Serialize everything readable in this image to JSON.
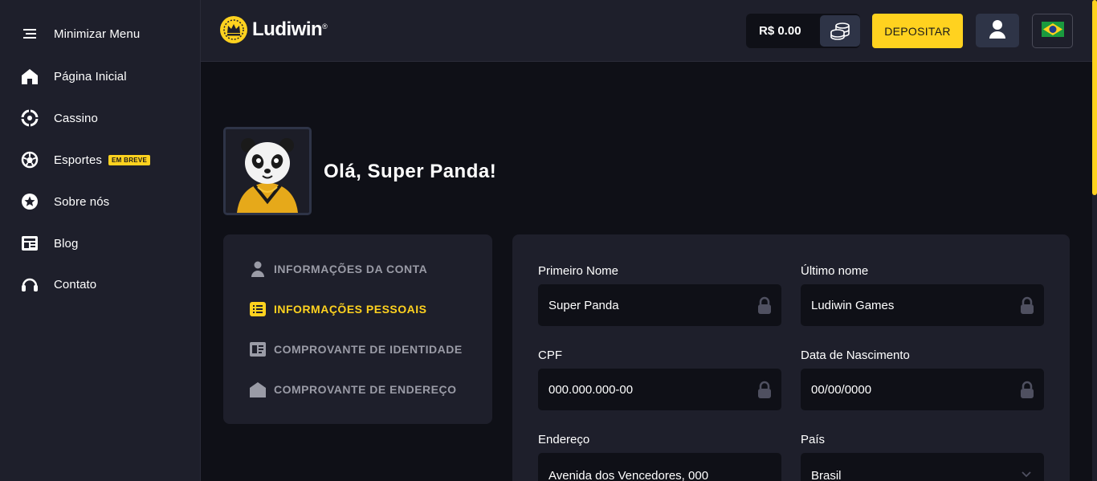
{
  "sidebar": {
    "items": [
      {
        "label": "Minimizar Menu",
        "icon": "menu-icon"
      },
      {
        "label": "Página Inicial",
        "icon": "home-icon"
      },
      {
        "label": "Cassino",
        "icon": "casino-chip-icon"
      },
      {
        "label": "Esportes",
        "icon": "soccer-ball-icon",
        "badge": "EM BREVE"
      },
      {
        "label": "Sobre nós",
        "icon": "star-icon"
      },
      {
        "label": "Blog",
        "icon": "newspaper-icon"
      },
      {
        "label": "Contato",
        "icon": "headset-icon"
      }
    ]
  },
  "header": {
    "logo_text": "Ludiwin",
    "logo_mark": "®",
    "balance": "R$ 0.00",
    "deposit_label": "DEPOSITAR"
  },
  "profile": {
    "greeting": "Olá, Super Panda!"
  },
  "account_menu": {
    "items": [
      {
        "label": "INFORMAÇÕES DA CONTA",
        "icon": "user-icon",
        "active": false
      },
      {
        "label": "INFORMAÇÕES PESSOAIS",
        "icon": "list-icon",
        "active": true
      },
      {
        "label": "COMPROVANTE DE IDENTIDADE",
        "icon": "id-card-icon",
        "active": false
      },
      {
        "label": "COMPROVANTE DE ENDEREÇO",
        "icon": "house-icon",
        "active": false
      }
    ]
  },
  "form": {
    "first_name": {
      "label": "Primeiro Nome",
      "value": "Super Panda"
    },
    "last_name": {
      "label": "Último nome",
      "value": "Ludiwin Games"
    },
    "cpf": {
      "label": "CPF",
      "value": "000.000.000-00"
    },
    "birth_date": {
      "label": "Data de Nascimento",
      "value": "00/00/0000"
    },
    "address": {
      "label": "Endereço",
      "value": "Avenida dos Vencedores, 000"
    },
    "country": {
      "label": "País",
      "value": "Brasil"
    }
  },
  "colors": {
    "accent": "#ffd21f",
    "sidebar_bg": "#1e1f2b",
    "page_bg": "#0f1017",
    "input_bg": "#0f1017",
    "muted_text": "#9a9ba6"
  }
}
